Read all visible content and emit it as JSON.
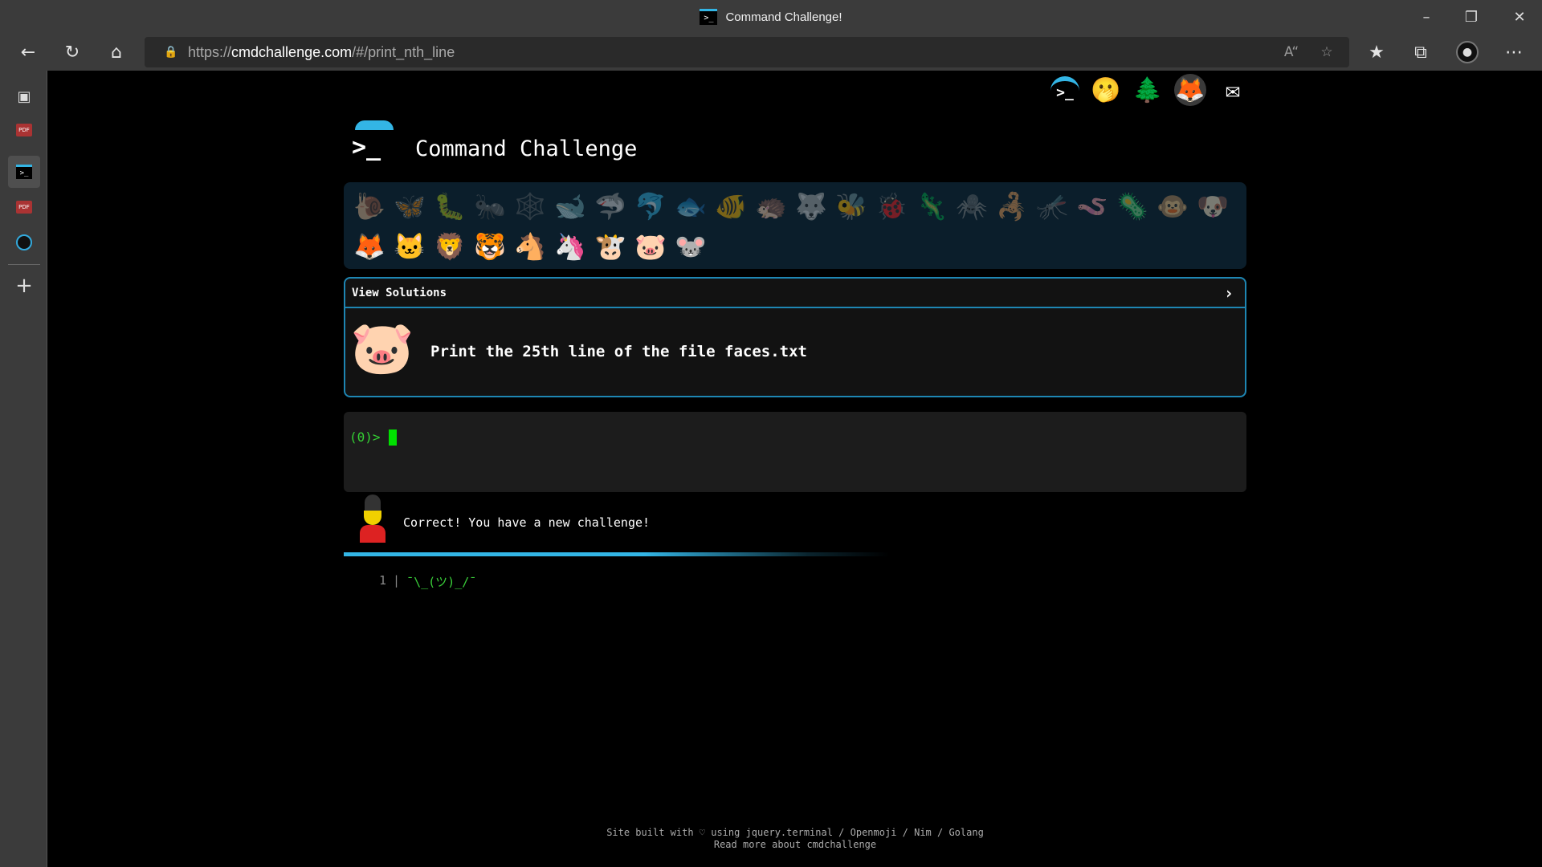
{
  "browser": {
    "window_title": "Command Challenge!",
    "favicon": "terminal-prompt-icon",
    "url_prefix": "https://",
    "url_host": "cmdchallenge.com",
    "url_path": "/#/print_nth_line",
    "toolbar_icons": [
      "back-icon",
      "refresh-icon",
      "home-icon",
      "lock-icon",
      "read-aloud-icon",
      "add-favorite-icon",
      "favorites-icon",
      "collections-icon",
      "profile-icon",
      "more-icon"
    ],
    "sidebar_icons": [
      "tab-actions-icon",
      "pdf-icon",
      "cmdchallenge-tab-icon",
      "pdf-icon",
      "speedometer-icon",
      "add-icon"
    ]
  },
  "header": {
    "site_title": "Command Challenge",
    "top_links": [
      "terminal-prompt-icon",
      "hand-over-mouth-emoji",
      "evergreen-tree-emoji",
      "gitlab-icon",
      "mail-icon"
    ]
  },
  "challenges": [
    {
      "emoji": "🐌",
      "done": true
    },
    {
      "emoji": "🦋",
      "done": true
    },
    {
      "emoji": "🐛",
      "done": true
    },
    {
      "emoji": "🐜",
      "done": true
    },
    {
      "emoji": "🕸️",
      "done": true
    },
    {
      "emoji": "🐋",
      "done": true
    },
    {
      "emoji": "🦈",
      "done": true
    },
    {
      "emoji": "🐬",
      "done": true
    },
    {
      "emoji": "🐟",
      "done": true
    },
    {
      "emoji": "🐠",
      "done": true
    },
    {
      "emoji": "🦔",
      "done": true
    },
    {
      "emoji": "🐺",
      "done": true
    },
    {
      "emoji": "🐝",
      "done": true
    },
    {
      "emoji": "🐞",
      "done": true
    },
    {
      "emoji": "🦎",
      "done": true
    },
    {
      "emoji": "🕷️",
      "done": true
    },
    {
      "emoji": "🦂",
      "done": true
    },
    {
      "emoji": "🦟",
      "done": true
    },
    {
      "emoji": "🪱",
      "done": true
    },
    {
      "emoji": "🦠",
      "done": true
    },
    {
      "emoji": "🐵",
      "done": true
    },
    {
      "emoji": "🐶",
      "done": true
    },
    {
      "emoji": "🦊",
      "done": false
    },
    {
      "emoji": "🐱",
      "done": false
    },
    {
      "emoji": "🦁",
      "done": false
    },
    {
      "emoji": "🐯",
      "done": false
    },
    {
      "emoji": "🐴",
      "done": false
    },
    {
      "emoji": "🦄",
      "done": false
    },
    {
      "emoji": "🐮",
      "done": false
    },
    {
      "emoji": "🐷",
      "done": false
    },
    {
      "emoji": "🐭",
      "done": false
    }
  ],
  "solutions": {
    "header": "View Solutions",
    "chevron": "›",
    "emoji": "🐷",
    "task": "Print the 25th line of the file faces.txt"
  },
  "terminal": {
    "prompt": "(0)>"
  },
  "feedback": {
    "avatar": "guard-emoji",
    "message": "Correct! You have a new challenge!"
  },
  "output": {
    "line_number": "1",
    "separator": "|",
    "text": "¯\\_(ツ)_/¯"
  },
  "footer": {
    "line1": "Site built with ♡ using jquery.terminal / Openmoji / Nim / Golang",
    "line2": "Read more about cmdchallenge"
  },
  "colors": {
    "accent": "#33b5e5",
    "prompt_green": "#34d134",
    "panel_bg": "#0b1e2b",
    "panel_border": "#1e86b3"
  }
}
